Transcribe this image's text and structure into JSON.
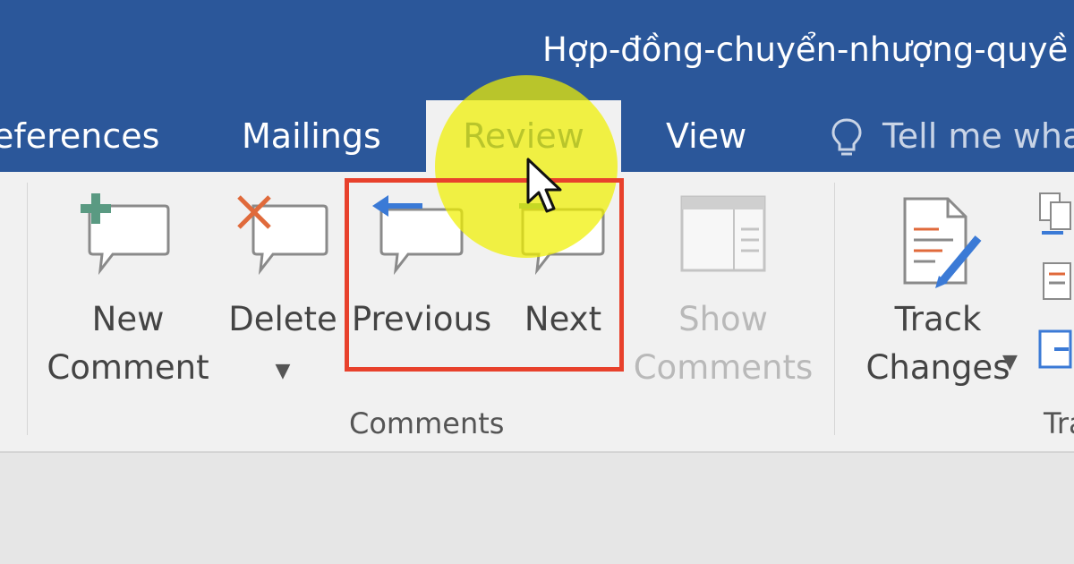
{
  "window": {
    "doc_title": "Hợp-đồng-chuyển-nhượng-quyề"
  },
  "tabs": [
    {
      "label": "eferences"
    },
    {
      "label": "Mailings"
    },
    {
      "label": "Review",
      "active": true
    },
    {
      "label": "View"
    }
  ],
  "tell_me": {
    "label": "Tell me wha",
    "icon": "lightbulb-icon"
  },
  "ribbon": {
    "comments_group": {
      "label": "Comments",
      "buttons": [
        {
          "label": "New\nComment",
          "icon": "new-comment-icon"
        },
        {
          "label": "Delete",
          "icon": "delete-comment-icon",
          "has_dropdown": true
        },
        {
          "label": "Previous",
          "icon": "previous-comment-icon"
        },
        {
          "label": "Next",
          "icon": "next-comment-icon"
        },
        {
          "label": "Show\nComments",
          "icon": "show-comments-icon",
          "disabled": true
        }
      ]
    },
    "tracking_group": {
      "label": "Tra",
      "buttons": [
        {
          "label": "Track\nChanges",
          "icon": "track-changes-icon",
          "has_dropdown": true
        }
      ]
    }
  },
  "colors": {
    "title_bar": "#2b579a",
    "ribbon_bg": "#f1f1f1",
    "highlight_box": "#e8412c",
    "cursor_highlight": "#f0f000",
    "add_plus": "#5a9a82",
    "delete_x": "#e06a3b",
    "nav_arrow": "#3b7ad6"
  }
}
